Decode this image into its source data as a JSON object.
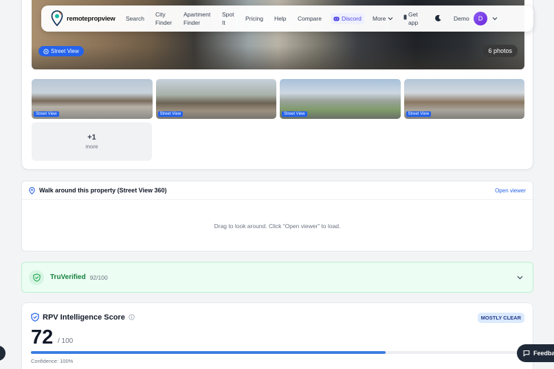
{
  "nav": {
    "logo_text": "remotepropview",
    "items": [
      {
        "label": "Search"
      },
      {
        "label": "City Finder"
      },
      {
        "label": "Apartment Finder"
      },
      {
        "label": "Spot It"
      },
      {
        "label": "Pricing"
      },
      {
        "label": "Help"
      },
      {
        "label": "Compare"
      },
      {
        "label": "Discord"
      },
      {
        "label": "More"
      },
      {
        "label": "Get app"
      }
    ],
    "user_name": "Demo",
    "avatar_initial": "D"
  },
  "gallery": {
    "main_badge": "Street View",
    "photos_count": "6 photos",
    "thumb_badge": "Street View",
    "more_count": "+1",
    "more_label": "more"
  },
  "street_view": {
    "title": "Walk around this property (Street View 360)",
    "open_label": "Open viewer",
    "hint": "Drag to look around. Click “Open viewer” to load."
  },
  "truverified": {
    "title": "TruVerified",
    "score": "92/100"
  },
  "intelligence": {
    "title": "RPV Intelligence Score",
    "badge": "MOSTLY CLEAR",
    "score": "72",
    "max": "/ 100",
    "score_fraction": 0.72,
    "confidence": "Confidence: 100%"
  },
  "feedback_label": "Feedback",
  "colors": {
    "accent": "#2563eb",
    "green": "#15803d",
    "bar": "#3b7de0",
    "discord": "#4f46e5"
  }
}
